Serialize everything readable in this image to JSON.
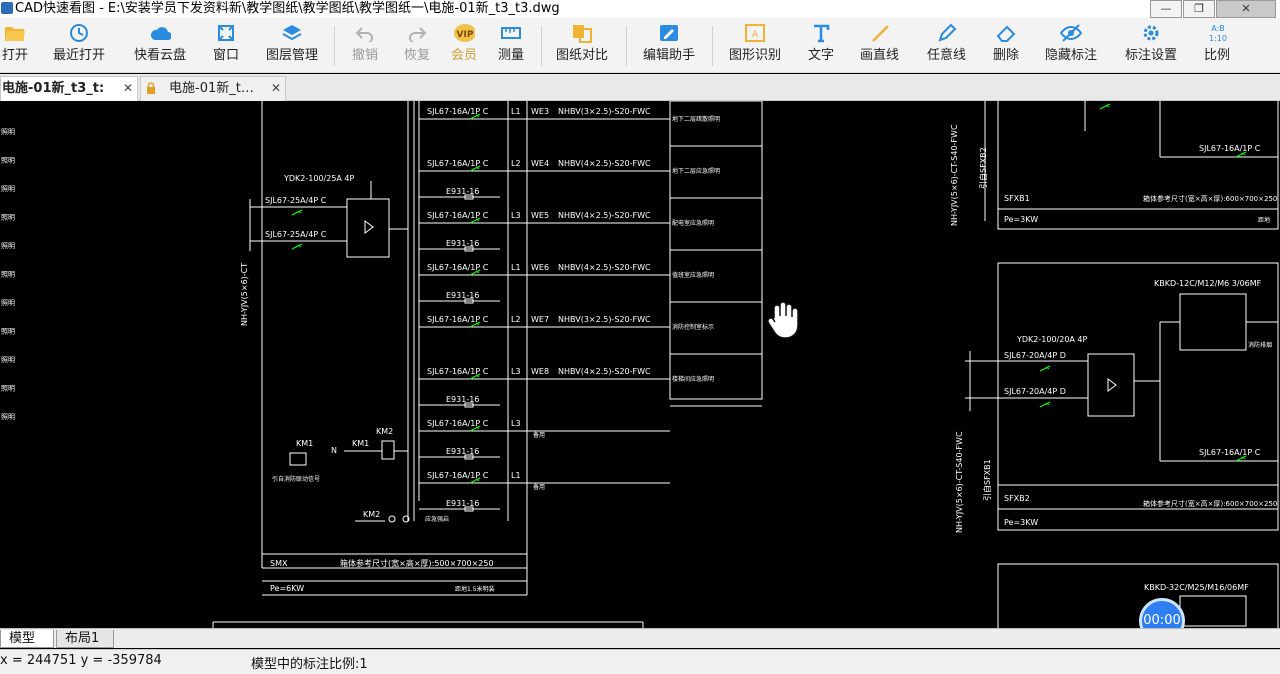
{
  "window": {
    "title": "CAD快速看图 - E:\\安装学员下发资料新\\教学图纸\\教学图纸\\教学图纸一\\电施-01新_t3_t3.dwg"
  },
  "toolbar": {
    "open": "打开",
    "recent": "最近打开",
    "cloud": "快看云盘",
    "window": "窗口",
    "layers": "图层管理",
    "undo": "撤销",
    "redo": "恢复",
    "vip": "会员",
    "measure": "测量",
    "compare": "图纸对比",
    "edit_helper": "编辑助手",
    "shape_recog": "图形识别",
    "text": "文字",
    "line": "画直线",
    "freeline": "任意线",
    "delete": "删除",
    "hide_dim": "隐藏标注",
    "dim_settings": "标注设置",
    "ratio": "比例",
    "vip_badge": "VIP",
    "ratio_icon_top": "A:B",
    "ratio_icon_bottom": "1:10"
  },
  "tabs": [
    {
      "label": "电施-01新_t3_t:"
    },
    {
      "label": "电施-01新_t…"
    }
  ],
  "drawing": {
    "left_panel": {
      "breakers": [
        {
          "code": "SJL67-16A/1P C",
          "phase": "L1",
          "circuit": "WE3",
          "cable": "NHBV(3×2.5)-S20-FWC",
          "note": "地下二层疏散照明"
        },
        {
          "code": "SJL67-16A/1P C",
          "phase": "L2",
          "circuit": "WE4",
          "cable": "NHBV(4×2.5)-S20-FWC",
          "note": "地下二层应急照明"
        },
        {
          "code": "SJL67-16A/1P C",
          "phase": "L3",
          "circuit": "WE5",
          "cable": "NHBV(4×2.5)-S20-FWC",
          "note": "配电室应急照明"
        },
        {
          "code": "SJL67-16A/1P C",
          "phase": "L1",
          "circuit": "WE6",
          "cable": "NHBV(4×2.5)-S20-FWC",
          "note": "值班室应急照明"
        },
        {
          "code": "SJL67-16A/1P C",
          "phase": "L2",
          "circuit": "WE7",
          "cable": "NHBV(3×2.5)-S20-FWC",
          "note": "消防控制室标示"
        },
        {
          "code": "SJL67-16A/1P C",
          "phase": "L3",
          "circuit": "WE8",
          "cable": "NHBV(4×2.5)-S20-FWC",
          "note": "楼梯间应急照明"
        },
        {
          "code": "SJL67-16A/1P C",
          "phase": "L3",
          "circuit": "",
          "cable": "",
          "note": "备用"
        },
        {
          "code": "SJL67-16A/1P C",
          "phase": "L1",
          "circuit": "",
          "cable": "",
          "note": "备用"
        }
      ],
      "spd": "E931-16",
      "ats": "YDK2-100/25A 4P",
      "incoming_1": "SJL67-25A/4P C",
      "incoming_2": "SJL67-25A/4P C",
      "feeder": "NH-YJV(5×6)-CT",
      "km1": "KM1",
      "km2": "KM2",
      "n_label": "N",
      "fire_link": "引自消防联动信号",
      "fire_switch": "应急强启",
      "box_name": "SMX",
      "box_size": "箱体参考尺寸(宽×高×厚):500×700×250",
      "power": "Pe=6KW",
      "mount": "距地1.5米明装"
    },
    "left_edge_notes": [
      "照明",
      "照明",
      "照明",
      "照明",
      "照明",
      "照明",
      "照明",
      "照明",
      "照明",
      "照明",
      "照明"
    ],
    "right_panel": {
      "box1_name": "SFXB1",
      "box1_size": "箱体参考尺寸(宽×高×厚):600×700×250",
      "box1_power": "Pe=3KW",
      "box1_mount": "距地",
      "box1_feeder": "NH-YJV(5×6)-CT-S40-FWC",
      "box1_src": "引自SFXB2",
      "breaker_top": "SJL67-16A/1P C",
      "kbkd1": "KBKD-12C/M12/M6 3/06MF",
      "ats2": "YDK2-100/20A 4P",
      "in2_1": "SJL67-20A/4P D",
      "in2_2": "SJL67-20A/4P D",
      "breaker_mid": "SJL67-16A/1P C",
      "note_right": "消防排烟",
      "box2_feeder": "NH-YJV(5×6)-CT-S40-FWC",
      "box2_src": "引自SFXB1",
      "box2_name": "SFXB2",
      "box2_size": "箱体参考尺寸(宽×高×厚):600×700×250",
      "box2_power": "Pe=3KW",
      "kbkd2": "KBKD-32C/M25/M16/06MF"
    }
  },
  "timer": "00:00",
  "layout_tabs": {
    "model": "模型",
    "layout1": "布局1"
  },
  "status": {
    "coords": "x = 244751  y = -359784",
    "scale": "模型中的标注比例:1"
  },
  "colors": {
    "cad_line": "#ffffff",
    "cad_text": "#ffffff",
    "breaker_contact": "#00ff00",
    "accent": "#2f7ef0"
  }
}
